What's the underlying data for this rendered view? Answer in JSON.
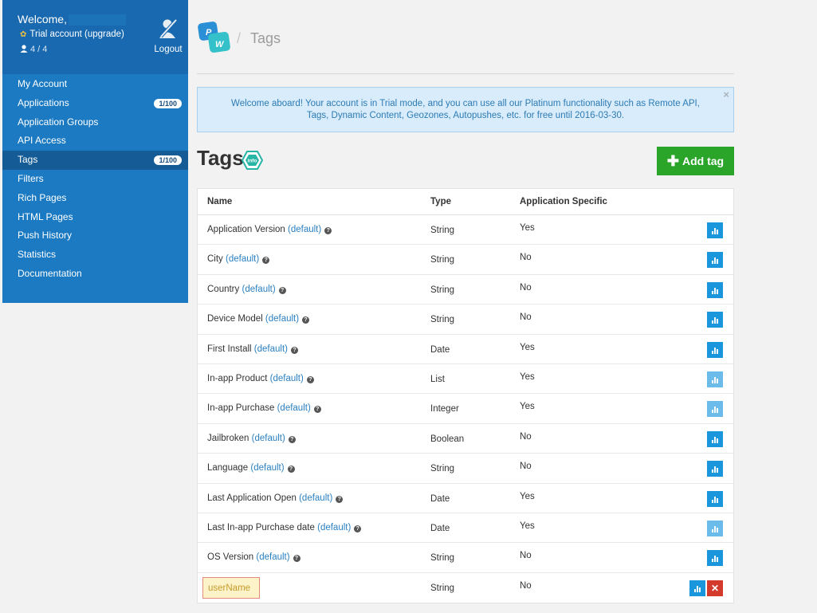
{
  "sidebar": {
    "welcome": "Welcome,",
    "trial": "Trial account (upgrade)",
    "users": "4 / 4",
    "logout": "Logout",
    "items": [
      {
        "label": "My Account"
      },
      {
        "label": "Applications",
        "count": "1/100"
      },
      {
        "label": "Application Groups"
      },
      {
        "label": "API Access"
      },
      {
        "label": "Tags",
        "count": "1/100"
      },
      {
        "label": "Filters"
      },
      {
        "label": "Rich Pages"
      },
      {
        "label": "HTML Pages"
      },
      {
        "label": "Push History"
      },
      {
        "label": "Statistics"
      },
      {
        "label": "Documentation"
      }
    ]
  },
  "header": {
    "logo_letters": [
      "P",
      "W"
    ],
    "separator": "/",
    "title": "Tags"
  },
  "alert": {
    "text": "Welcome aboard! Your account is in Trial mode, and you can use all our Platinum functionality such as Remote API, Tags, Dynamic Content, Geozones, Autopushes, etc. for free until 2016-03-30.",
    "close": "×"
  },
  "page": {
    "heading": "Tags",
    "info_label": "info",
    "add_button": "Add tag"
  },
  "table": {
    "columns": [
      "Name",
      "Type",
      "Application Specific"
    ],
    "default_label": "(default)",
    "rows": [
      {
        "name": "Application Version",
        "type": "String",
        "app_specific": "Yes"
      },
      {
        "name": "City",
        "type": "String",
        "app_specific": "No"
      },
      {
        "name": "Country",
        "type": "String",
        "app_specific": "No"
      },
      {
        "name": "Device Model",
        "type": "String",
        "app_specific": "No"
      },
      {
        "name": "First Install",
        "type": "Date",
        "app_specific": "Yes"
      },
      {
        "name": "In-app Product",
        "type": "List",
        "app_specific": "Yes"
      },
      {
        "name": "In-app Purchase",
        "type": "Integer",
        "app_specific": "Yes"
      },
      {
        "name": "Jailbroken",
        "type": "Boolean",
        "app_specific": "No"
      },
      {
        "name": "Language",
        "type": "String",
        "app_specific": "No"
      },
      {
        "name": "Last Application Open",
        "type": "Date",
        "app_specific": "Yes"
      },
      {
        "name": "Last In-app Purchase date",
        "type": "Date",
        "app_specific": "Yes"
      },
      {
        "name": "OS Version",
        "type": "String",
        "app_specific": "No"
      },
      {
        "name": "userName",
        "type": "String",
        "app_specific": "No"
      }
    ]
  },
  "colors": {
    "sidebar": "#1b7ac2",
    "active_item": "#155c96",
    "link": "#2b80c1",
    "add_button": "#2aa52a",
    "stats_button": "#1a96dc",
    "delete_button": "#d33a2c"
  }
}
